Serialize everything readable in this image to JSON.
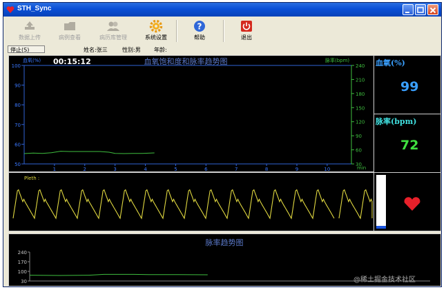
{
  "window": {
    "title": "STH_Sync"
  },
  "toolbar": {
    "items": [
      {
        "label": "数据上传",
        "icon": "upload-icon",
        "enabled": false
      },
      {
        "label": "病例查看",
        "icon": "folder-icon",
        "enabled": false
      },
      {
        "label": "病历库管理",
        "icon": "users-icon",
        "enabled": false
      },
      {
        "label": "系统设置",
        "icon": "gear-icon",
        "enabled": true
      },
      {
        "label": "帮助",
        "icon": "help-icon",
        "enabled": true
      },
      {
        "label": "退出",
        "icon": "power-icon",
        "enabled": true
      }
    ]
  },
  "infobar": {
    "stop_label": "停止(S)",
    "name": "姓名:张三",
    "gender": "性别:男",
    "age": "年龄:"
  },
  "trend": {
    "title": "血氧饱和度和脉率趋势图",
    "timer": "00:15:12",
    "left_axis_label": "血氧(%)",
    "right_axis_label": "脉率(bpm)",
    "unit_label": "min"
  },
  "spo2": {
    "label": "血氧(%)",
    "value": "99",
    "color": "#3aa0ff"
  },
  "pulse": {
    "label": "脉率(bpm)",
    "value": "72",
    "color": "#40e040"
  },
  "pleth": {
    "label": "Pleth :"
  },
  "pulse_trend": {
    "title": "脉率趋势图"
  },
  "watermark": "@稀土掘金技术社区",
  "chart_data": [
    {
      "type": "line",
      "title": "血氧饱和度和脉率趋势图",
      "x_unit": "min",
      "xlim": [
        0,
        10.8
      ],
      "x_ticks": [
        1,
        2,
        3,
        4,
        5,
        6,
        7,
        8,
        9,
        10
      ],
      "y_left": {
        "label": "血氧(%)",
        "ylim": [
          50,
          100
        ],
        "ticks": [
          100,
          90,
          80,
          70,
          60,
          50
        ]
      },
      "y_right": {
        "label": "脉率(bpm)",
        "ylim": [
          30,
          240
        ],
        "ticks": [
          240,
          210,
          180,
          150,
          120,
          90,
          60,
          30
        ]
      },
      "series": [
        {
          "axis": "right",
          "color": "#3fbf3f",
          "points": [
            [
              0,
              52
            ],
            [
              0.3,
              53
            ],
            [
              0.6,
              52.5
            ],
            [
              0.9,
              54
            ],
            [
              1.2,
              57
            ],
            [
              1.5,
              56.5
            ],
            [
              2.0,
              56.5
            ],
            [
              2.5,
              56.5
            ],
            [
              2.8,
              55
            ],
            [
              3.0,
              52.5
            ],
            [
              3.3,
              52
            ],
            [
              3.6,
              52.5
            ],
            [
              3.9,
              52.5
            ],
            [
              4.3,
              53.5
            ]
          ]
        }
      ]
    },
    {
      "type": "line",
      "title": "脉率趋势图",
      "y_ticks": [
        240,
        170,
        100,
        30
      ],
      "ylim": [
        30,
        240
      ],
      "xlim": [
        0,
        10.8
      ],
      "series": [
        {
          "color": "#3fbf3f",
          "points": [
            [
              0,
              72
            ],
            [
              0.8,
              70
            ],
            [
              1.6,
              72
            ],
            [
              2.0,
              78
            ],
            [
              2.8,
              78
            ],
            [
              3.2,
              76
            ],
            [
              4.0,
              76
            ],
            [
              4.8,
              75
            ]
          ]
        }
      ]
    }
  ]
}
